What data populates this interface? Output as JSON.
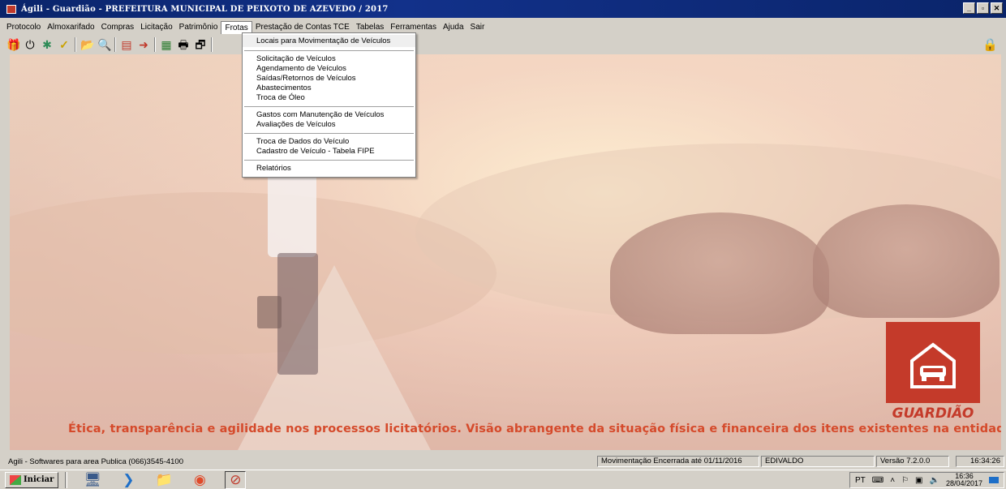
{
  "window": {
    "title": "Ágili - Guardião - PREFEITURA MUNICIPAL DE PEIXOTO DE AZEVEDO / 2017",
    "controls": [
      "_",
      "▫",
      "✕"
    ]
  },
  "menu": {
    "items": [
      "Protocolo",
      "Almoxarifado",
      "Compras",
      "Licitação",
      "Patrimônio",
      "Frotas",
      "Prestação de Contas TCE",
      "Tabelas",
      "Ferramentas",
      "Ajuda",
      "Sair"
    ],
    "active": "Frotas"
  },
  "toolbar": {
    "icons": [
      "gift-icon",
      "power-icon",
      "puzzle-icon",
      "check-icon",
      "folder-icon",
      "binoculars-icon",
      "report-icon",
      "export-icon",
      "card-icon",
      "printer-icon",
      "properties-icon"
    ],
    "glyphs": [
      "🎁",
      "⏻",
      "✱",
      "✓",
      "📂",
      "🔍",
      "▤",
      "➜",
      "▦",
      "🖶",
      "🗗"
    ],
    "right_icon": "🔒"
  },
  "dropdown": {
    "groups": [
      [
        "Locais para Movimentação de Veículos"
      ],
      [
        "Solicitação de Veículos",
        "Agendamento de Veículos",
        "Saídas/Retornos de Veículos",
        "Abastecimentos",
        "Troca de Óleo"
      ],
      [
        "Gastos com Manutenção de Veículos",
        "Avaliações de Veículos"
      ],
      [
        "Troca de Dados do Veículo",
        "Cadastro de Veículo - Tabela FIPE"
      ],
      [
        "Relatórios"
      ]
    ]
  },
  "background": {
    "slogan": "Ética, transparência e agilidade nos processos licitatórios. Visão abrangente da situação física e financeira dos itens existentes na entidade.",
    "logo_text": "GUARDIÃO",
    "accent_color": "#c43a2a"
  },
  "status": {
    "left": "Agili - Softwares para area Publica (066)3545-4100",
    "movement": "Movimentação Encerrada até 01/11/2016",
    "user": "EDIVALDO",
    "version": "Versão 7.2.0.0",
    "time": "16:34:26"
  },
  "taskbar": {
    "start_label": "Iniciar",
    "language": "PT",
    "clock_time": "16:36",
    "clock_date": "28/04/2017"
  }
}
